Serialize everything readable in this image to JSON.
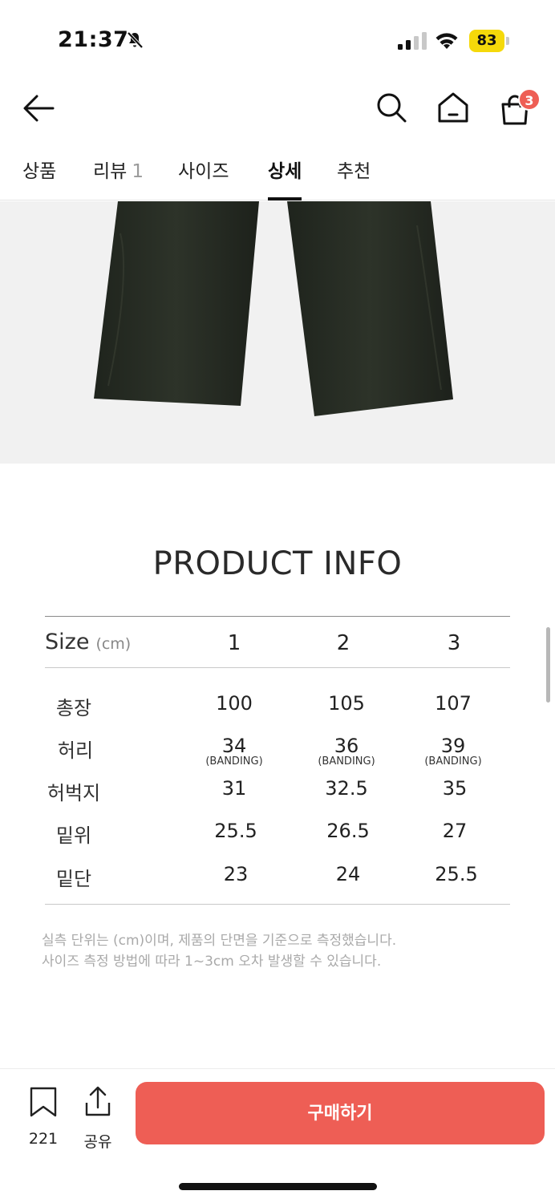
{
  "status_bar": {
    "time": "21:37",
    "battery": "83",
    "icons": [
      "bell-slash-icon",
      "signal-icon",
      "wifi-icon",
      "battery-icon"
    ],
    "battery_color": "#f5d90a"
  },
  "header": {
    "icons": [
      "arrow-left-icon",
      "search-icon",
      "home-icon",
      "shopping-bag-icon"
    ],
    "cart_count": "3",
    "accent": "#ee5e55"
  },
  "tabs": [
    {
      "label": "상품",
      "count": ""
    },
    {
      "label": "리뷰",
      "count": "1"
    },
    {
      "label": "사이즈",
      "count": ""
    },
    {
      "label": "상세",
      "count": ""
    },
    {
      "label": "추천",
      "count": ""
    }
  ],
  "active_tab": "상세",
  "product_info": {
    "title": "PRODUCT INFO",
    "size_label": "Size",
    "size_unit": "(cm)",
    "sizes": [
      "1",
      "2",
      "3"
    ],
    "rows": [
      {
        "name": "총장",
        "values": [
          "100",
          "105",
          "107"
        ],
        "notes": [
          "",
          "",
          ""
        ]
      },
      {
        "name": "허리",
        "values": [
          "34",
          "36",
          "39"
        ],
        "notes": [
          "(BANDING)",
          "(BANDING)",
          "(BANDING)"
        ]
      },
      {
        "name": "허벅지",
        "values": [
          "31",
          "32.5",
          "35"
        ],
        "notes": [
          "",
          "",
          ""
        ]
      },
      {
        "name": "밑위",
        "values": [
          "25.5",
          "26.5",
          "27"
        ],
        "notes": [
          "",
          "",
          ""
        ]
      },
      {
        "name": "밑단",
        "values": [
          "23",
          "24",
          "25.5"
        ],
        "notes": [
          "",
          "",
          ""
        ]
      }
    ],
    "notes": [
      "실측 단위는 (cm)이며, 제품의 단면을 기준으로 측정했습니다.",
      "사이즈 측정 방법에 따라 1~3cm 오차 발생할 수 있습니다."
    ]
  },
  "bottom_bar": {
    "bookmark_count": "221",
    "share_label": "공유",
    "buy_label": "구매하기",
    "buy_color": "#ee5e55"
  }
}
